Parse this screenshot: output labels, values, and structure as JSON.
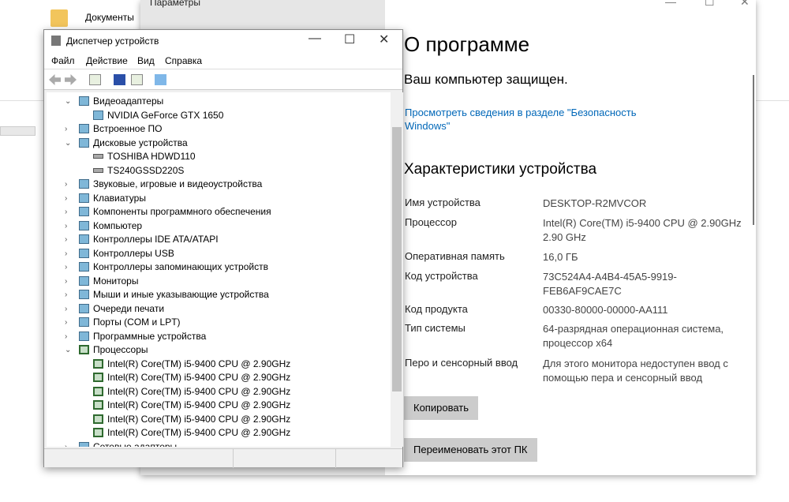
{
  "desktop": {
    "documents_label": "Документы"
  },
  "settings": {
    "title": "Параметры",
    "minimize": "—",
    "maximize": "☐",
    "close": "✕",
    "about_title": "О программе",
    "protected": "Ваш компьютер защищен.",
    "security_link": "Просмотреть сведения в разделе \"Безопасность Windows\"",
    "specs_heading": "Характеристики устройства",
    "specs": [
      {
        "label": "Имя устройства",
        "value": "DESKTOP-R2MVCOR"
      },
      {
        "label": "Процессор",
        "value": "Intel(R) Core(TM) i5-9400 CPU @ 2.90GHz   2.90 GHz"
      },
      {
        "label": "Оперативная память",
        "value": "16,0 ГБ"
      },
      {
        "label": "Код устройства",
        "value": "73C524A4-A4B4-45A5-9919-FEB6AF9CAE7C"
      },
      {
        "label": "Код продукта",
        "value": "00330-80000-00000-AA111"
      },
      {
        "label": "Тип системы",
        "value": "64-разрядная операционная система, процессор x64"
      },
      {
        "label": "Перо и сенсорный ввод",
        "value": "Для этого монитора недоступен ввод с помощью пера и сенсорный ввод"
      }
    ],
    "copy_button": "Копировать",
    "rename_button": "Переименовать этот ПК"
  },
  "device_manager": {
    "title": "Диспетчер устройств",
    "minimize": "—",
    "maximize": "☐",
    "close": "✕",
    "menu": [
      "Файл",
      "Действие",
      "Вид",
      "Справка"
    ],
    "tree": [
      {
        "label": "Видеоадаптеры",
        "level": 0,
        "expanded": true
      },
      {
        "label": "NVIDIA GeForce GTX 1650",
        "level": 1
      },
      {
        "label": "Встроенное ПО",
        "level": 0
      },
      {
        "label": "Дисковые устройства",
        "level": 0,
        "expanded": true
      },
      {
        "label": "TOSHIBA HDWD110",
        "level": 1,
        "kind": "disk"
      },
      {
        "label": "TS240GSSD220S",
        "level": 1,
        "kind": "disk"
      },
      {
        "label": "Звуковые, игровые и видеоустройства",
        "level": 0
      },
      {
        "label": "Клавиатуры",
        "level": 0
      },
      {
        "label": "Компоненты программного обеспечения",
        "level": 0
      },
      {
        "label": "Компьютер",
        "level": 0
      },
      {
        "label": "Контроллеры IDE ATA/ATAPI",
        "level": 0
      },
      {
        "label": "Контроллеры USB",
        "level": 0
      },
      {
        "label": "Контроллеры запоминающих устройств",
        "level": 0
      },
      {
        "label": "Мониторы",
        "level": 0
      },
      {
        "label": "Мыши и иные указывающие устройства",
        "level": 0
      },
      {
        "label": "Очереди печати",
        "level": 0
      },
      {
        "label": "Порты (COM и LPT)",
        "level": 0
      },
      {
        "label": "Программные устройства",
        "level": 0
      },
      {
        "label": "Процессоры",
        "level": 0,
        "expanded": true,
        "kind": "cpu"
      },
      {
        "label": "Intel(R) Core(TM) i5-9400 CPU @ 2.90GHz",
        "level": 1,
        "kind": "cpu"
      },
      {
        "label": "Intel(R) Core(TM) i5-9400 CPU @ 2.90GHz",
        "level": 1,
        "kind": "cpu"
      },
      {
        "label": "Intel(R) Core(TM) i5-9400 CPU @ 2.90GHz",
        "level": 1,
        "kind": "cpu"
      },
      {
        "label": "Intel(R) Core(TM) i5-9400 CPU @ 2.90GHz",
        "level": 1,
        "kind": "cpu"
      },
      {
        "label": "Intel(R) Core(TM) i5-9400 CPU @ 2.90GHz",
        "level": 1,
        "kind": "cpu"
      },
      {
        "label": "Intel(R) Core(TM) i5-9400 CPU @ 2.90GHz",
        "level": 1,
        "kind": "cpu"
      },
      {
        "label": "Сетевые адаптеры",
        "level": 0
      }
    ]
  }
}
